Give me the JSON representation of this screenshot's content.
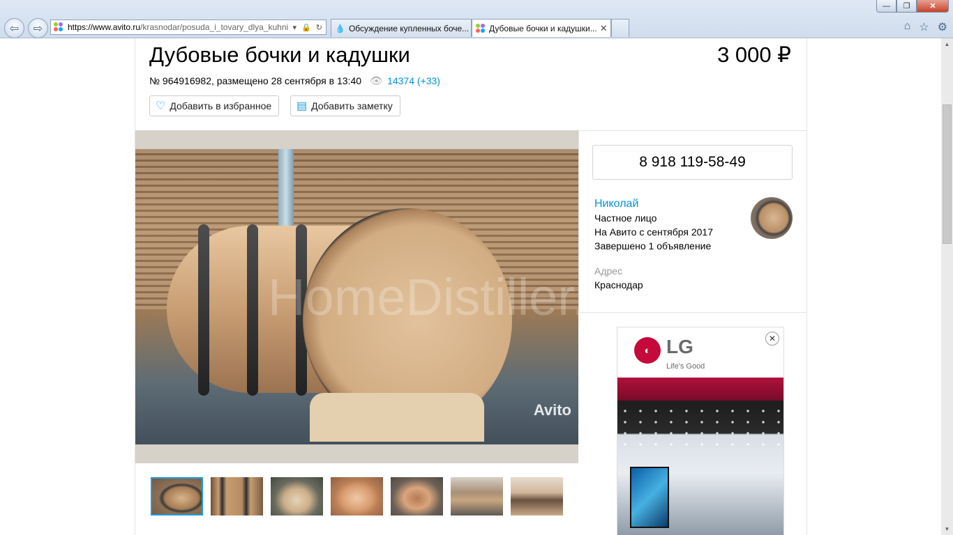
{
  "browser": {
    "url_host": "https://www.avito.ru",
    "url_path": "/krasnodar/posuda_i_tovary_dlya_kuhni",
    "tabs": [
      {
        "label": "Обсуждение купленных боче...",
        "active": false
      },
      {
        "label": "Дубовые бочки и кадушки...",
        "active": true
      }
    ],
    "window_buttons": {
      "minimize": "—",
      "restore": "❐",
      "close": "✕"
    },
    "icons": [
      "back-icon",
      "forward-icon",
      "home-icon",
      "favorites-star-icon",
      "settings-gear-icon"
    ]
  },
  "listing": {
    "title": "Дубовые бочки и кадушки",
    "price": "3 000 ₽",
    "meta_text": "№ 964916982, размещено 28 сентября в 13:40",
    "views": "14374 (+33)",
    "favorite_label": "Добавить в избранное",
    "note_label": "Добавить заметку",
    "photo_watermark": "HomeDistiller.ru",
    "photo_brand": "Avito",
    "thumbnails_count": 7
  },
  "seller": {
    "phone": "8 918 119-58-49",
    "name": "Николай",
    "type": "Частное лицо",
    "since": "На Авито с сентября 2017",
    "completed": "Завершено 1 объявление",
    "address_label": "Адрес",
    "address_value": "Краснодар"
  },
  "ad": {
    "brand": "LG",
    "tagline": "Life's Good",
    "close": "✕"
  },
  "colors": {
    "link": "#0091d9",
    "thumb_selected": "#1e9be0",
    "lg_red": "#c6093b"
  }
}
